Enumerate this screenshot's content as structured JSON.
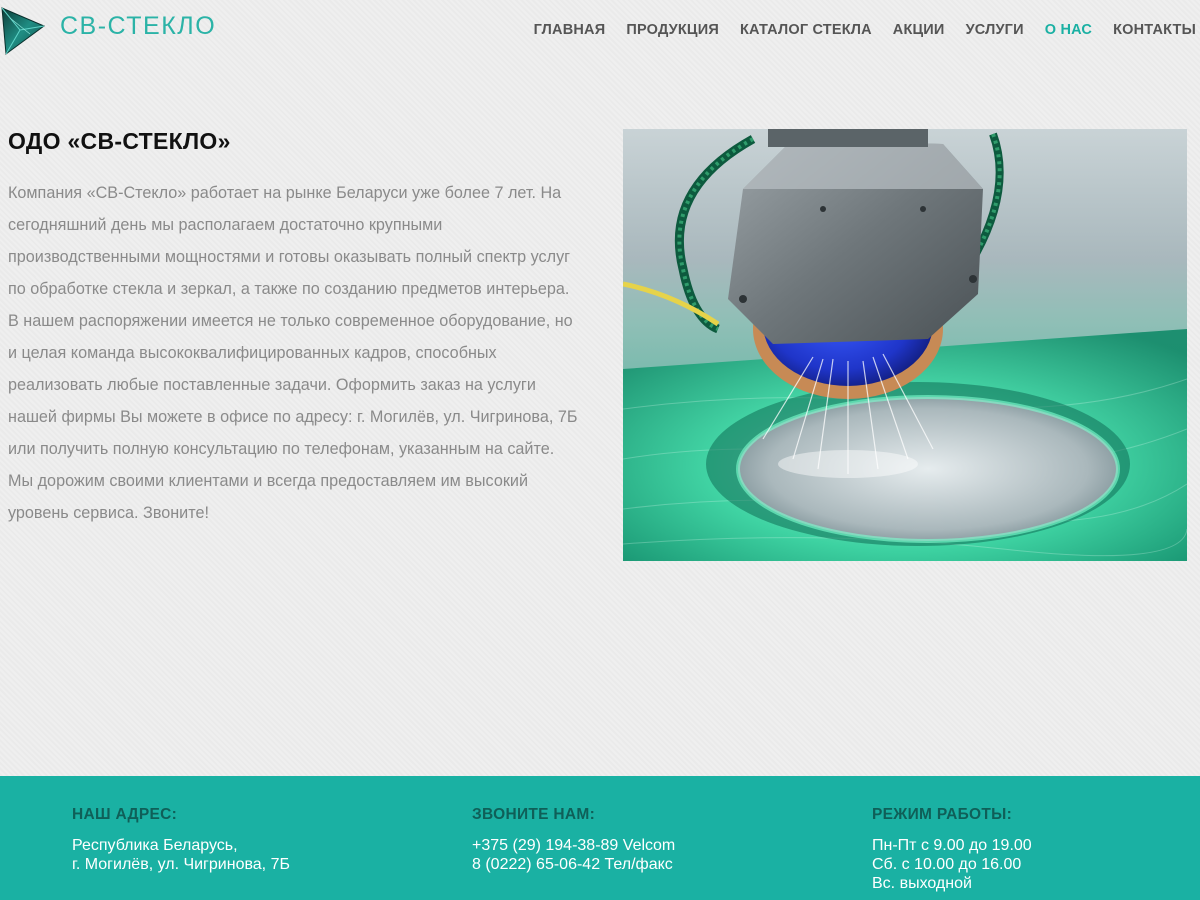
{
  "brand": {
    "name": "СВ-СТЕКЛО",
    "logo_icon": "triangle-glass-logo-icon"
  },
  "nav": {
    "items": [
      {
        "label": "ГЛАВНАЯ",
        "active": false
      },
      {
        "label": "ПРОДУКЦИЯ",
        "active": false
      },
      {
        "label": "КАТАЛОГ СТЕКЛА",
        "active": false
      },
      {
        "label": "АКЦИИ",
        "active": false
      },
      {
        "label": "УСЛУГИ",
        "active": false
      },
      {
        "label": "О НАС",
        "active": true
      },
      {
        "label": "КОНТАКТЫ",
        "active": false
      }
    ]
  },
  "about": {
    "title": "ОДО «СВ-СТЕКЛО»",
    "text": "Компания «СВ-Стекло» работает на рынке Беларуси уже более 7 лет. На сегодняшний день мы располагаем достаточно крупными производственными мощностями и готовы оказывать полный спектр услуг по обработке стекла и зеркал, а также по созданию предметов интерьера. В нашем распоряжении имеется не только современное оборудование, но и целая команда высококвалифицированных кадров, способных реализовать любые поставленные задачи. Оформить заказ на услуги нашей фирмы Вы можете в офисе по адресу: г. Могилёв, ул. Чигринова, 7Б или получить полную консультацию по телефонам, указанным на сайте. Мы дорожим своими клиентами и всегда предоставляем им высокий уровень сервиса. Звоните!"
  },
  "footer": {
    "address": {
      "heading": "НАШ АДРЕС:",
      "lines": [
        "Республика Беларусь,",
        "г. Могилёв, ул. Чигринова, 7Б"
      ]
    },
    "phones": {
      "heading": "ЗВОНИТЕ НАМ:",
      "lines": [
        "+375 (29) 194-38-89 Velcom",
        "8 (0222) 65-06-42 Тел/факс"
      ]
    },
    "hours": {
      "heading": "РЕЖИМ РАБОТЫ:",
      "lines": [
        "Пн-Пт с 9.00 до 19.00",
        "Сб. с 10.00 до 16.00",
        "Вс. выходной"
      ]
    }
  },
  "colors": {
    "accent": "#1ab1a3",
    "footer_heading": "#0f5f58",
    "body_text": "#8a8a8a"
  }
}
